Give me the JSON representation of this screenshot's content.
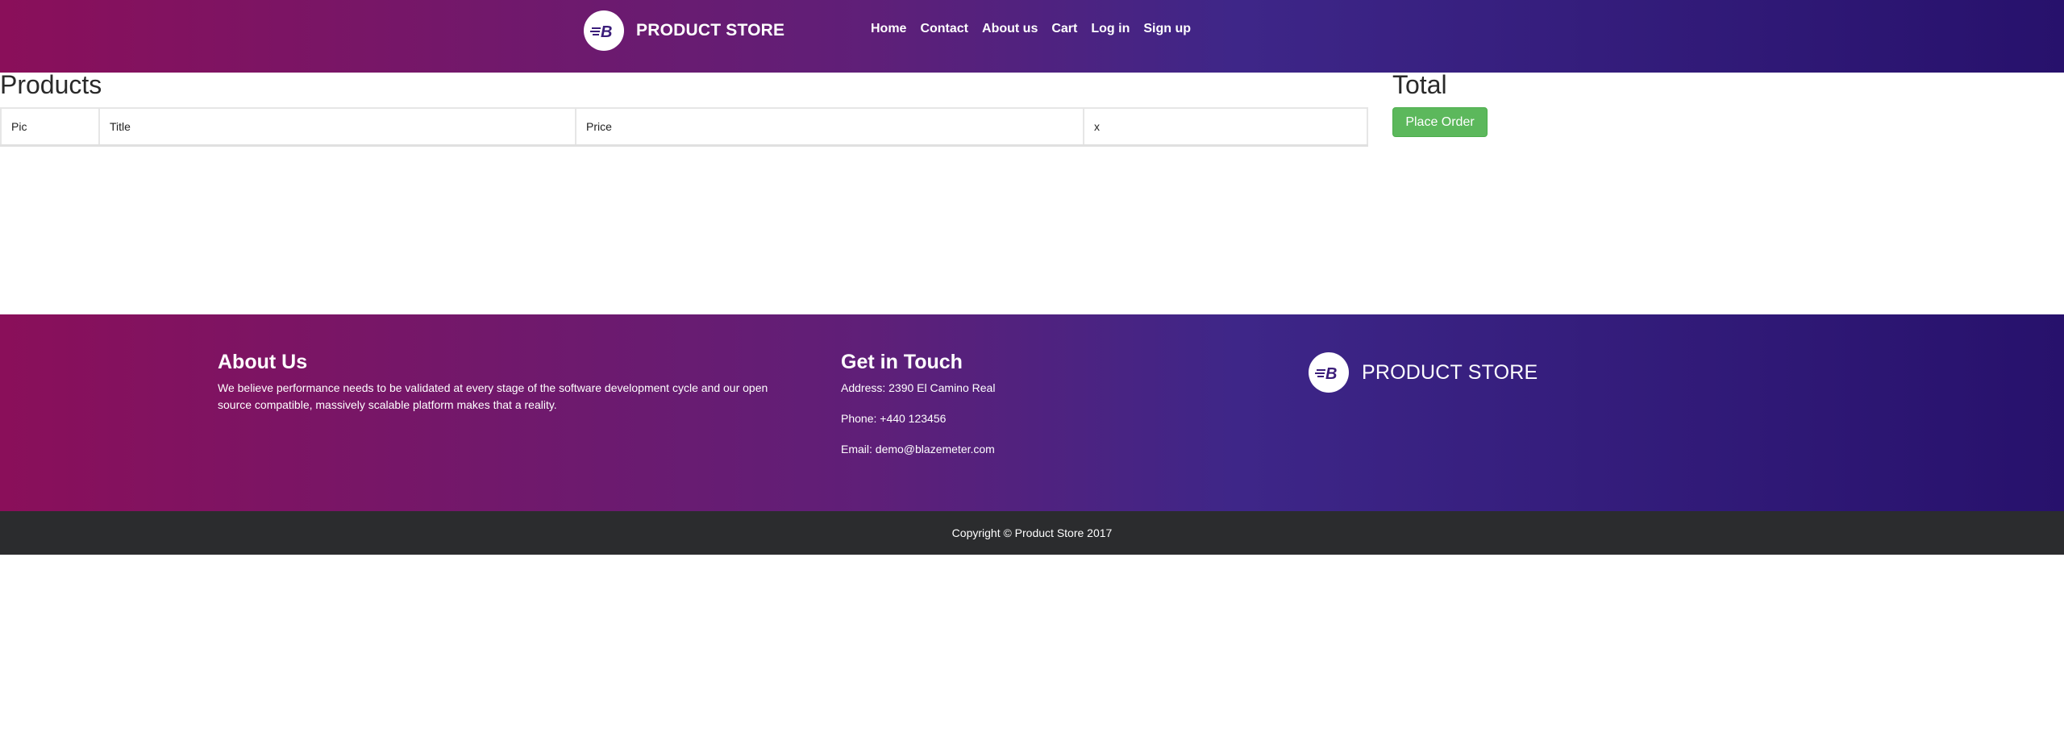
{
  "header": {
    "brand": "PRODUCT STORE",
    "nav": [
      "Home",
      "Contact",
      "About us",
      "Cart",
      "Log in",
      "Sign up"
    ]
  },
  "main": {
    "products_title": "Products",
    "table_headers": [
      "Pic",
      "Title",
      "Price",
      "x"
    ],
    "total_title": "Total",
    "place_order_label": "Place Order"
  },
  "footer": {
    "about_title": "About Us",
    "about_text": "We believe performance needs to be validated at every stage of the software development cycle and our open source compatible, massively scalable platform makes that a reality.",
    "touch_title": "Get in Touch",
    "address": "Address: 2390 El Camino Real",
    "phone": "Phone: +440 123456",
    "email": "Email: demo@blazemeter.com",
    "brand": "PRODUCT STORE",
    "copyright": "Copyright © Product Store 2017"
  },
  "colors": {
    "gradient_start": "#8a0f5a",
    "gradient_end": "#27116c",
    "button_green": "#5cb85c",
    "copyright_bg": "#2b2c2e"
  },
  "icons": [
    "blazemeter-logo-icon"
  ]
}
